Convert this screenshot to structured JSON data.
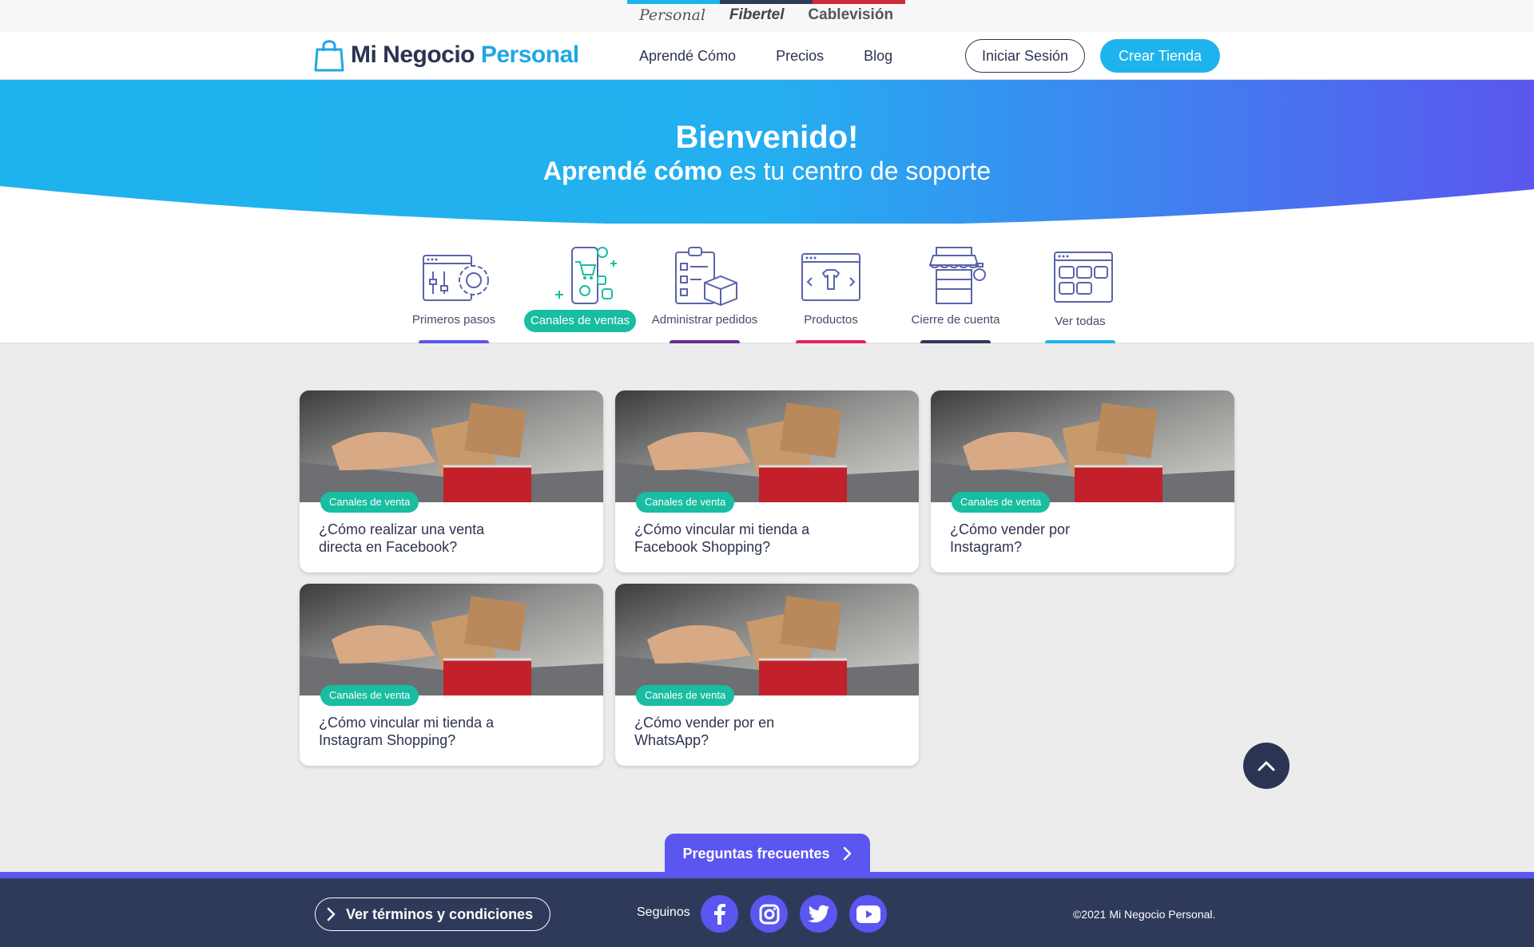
{
  "brand_strip": {
    "links": [
      "Personal",
      "Fibertel",
      "Cablevisión"
    ],
    "bar_colors": [
      "#1eb3ec",
      "#2f3a5b",
      "#d02a3a"
    ]
  },
  "header": {
    "logo_main": "Mi Negocio",
    "logo_accent": "Personal",
    "nav": [
      "Aprendé Cómo",
      "Precios",
      "Blog"
    ],
    "login_label": "Iniciar Sesión",
    "create_label": "Crear Tienda"
  },
  "hero": {
    "title": "Bienvenido!",
    "subtitle_bold": "Aprendé cómo",
    "subtitle_rest": "es tu centro de soporte",
    "gradient": [
      "#1eb3ec",
      "#5a56ef"
    ]
  },
  "categories": [
    {
      "label": "Primeros pasos",
      "icon": "settings-panel-icon",
      "bar_color": "#5a56ef",
      "active": false
    },
    {
      "label": "Canales de ventas",
      "icon": "mobile-shop-icon",
      "bar_color": "#19bda1",
      "active": true
    },
    {
      "label": "Administrar pedidos",
      "icon": "clipboard-box-icon",
      "bar_color": "#6a2b98",
      "active": false
    },
    {
      "label": "Productos",
      "icon": "browser-shirt-icon",
      "bar_color": "#e5245f",
      "active": false
    },
    {
      "label": "Cierre de cuenta",
      "icon": "store-icon",
      "bar_color": "#2f3a5b",
      "active": false
    },
    {
      "label": "Ver todas",
      "icon": "grid-window-icon",
      "bar_color": "#1eb3ec",
      "active": false
    }
  ],
  "cards": [
    {
      "tag": "Canales de venta",
      "title": "¿Cómo realizar una venta directa en Facebook?"
    },
    {
      "tag": "Canales de venta",
      "title": "¿Cómo vincular mi tienda a Facebook Shopping?"
    },
    {
      "tag": "Canales de venta",
      "title": "¿Cómo vender por Instagram?"
    },
    {
      "tag": "Canales de venta",
      "title": "¿Cómo vincular mi tienda a Instagram Shopping?"
    },
    {
      "tag": "Canales de venta",
      "title": "¿Cómo vender por en WhatsApp?"
    }
  ],
  "faq": {
    "label": "Preguntas frecuentes"
  },
  "footer": {
    "terms_label": "Ver términos y condiciones",
    "follow_label": "Seguinos",
    "socials": [
      "facebook-icon",
      "instagram-icon",
      "twitter-icon",
      "youtube-icon"
    ],
    "copyright": "©2021 Mi Negocio Personal."
  }
}
